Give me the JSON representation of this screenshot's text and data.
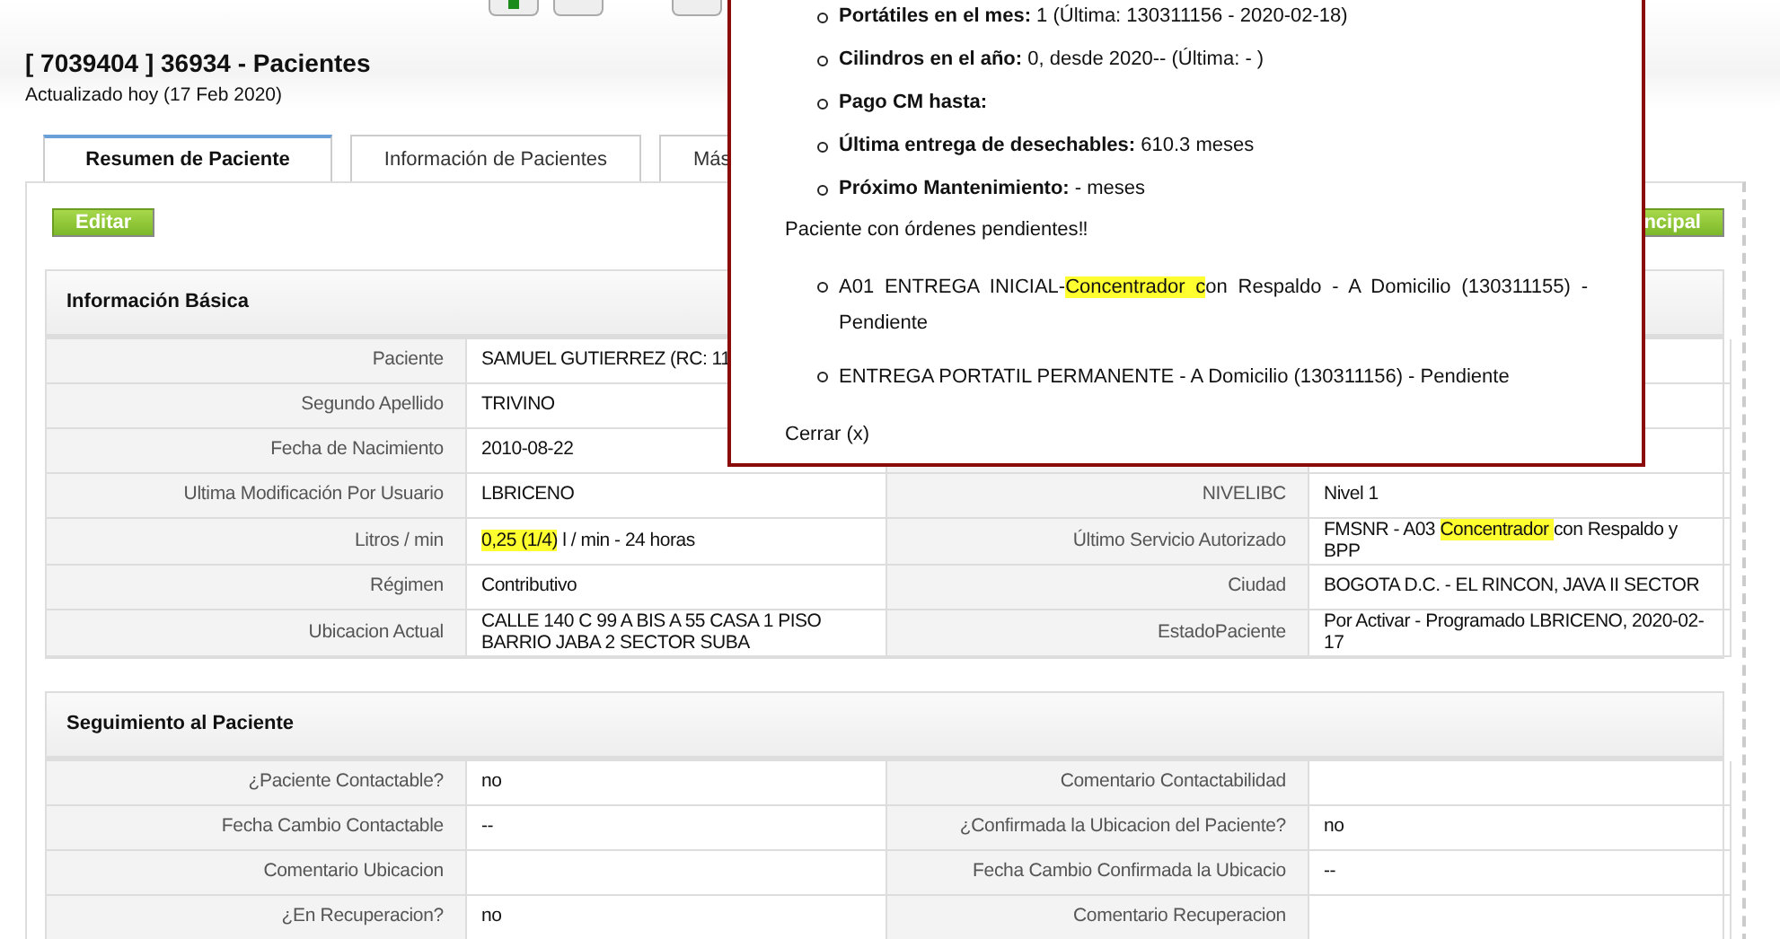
{
  "header": {
    "title": "[ 7039404 ] 36934 - Pacientes",
    "subtitle": "Actualizado hoy (17 Feb 2020)"
  },
  "tabs": [
    {
      "label": "Resumen de Paciente",
      "selected": true
    },
    {
      "label": "Información de Pacientes",
      "selected": false
    },
    {
      "label": "Más",
      "selected": false
    }
  ],
  "actions": {
    "edit": "Editar",
    "right_button": "ncipal"
  },
  "basic_info": {
    "title": "Información Básica",
    "rows": [
      {
        "left": {
          "label": "Paciente",
          "value": [
            {
              "text": "SAMUEL GUTIERREZ (RC: 11",
              "highlighted": false
            }
          ]
        }
      },
      {
        "left": {
          "label": "Segundo Apellido",
          "value": [
            {
              "text": "TRIVINO",
              "highlighted": false
            }
          ]
        }
      },
      {
        "left": {
          "label": "Fecha de Nacimiento",
          "value": [
            {
              "text": "2010-08-22",
              "highlighted": false
            }
          ]
        }
      },
      {
        "left": {
          "label": "Ultima Modificación Por Usuario",
          "value": [
            {
              "text": "LBRICENO",
              "highlighted": false
            }
          ]
        },
        "right": {
          "label": "NIVELIBC",
          "value": [
            {
              "text": "Nivel 1",
              "highlighted": false
            }
          ]
        }
      },
      {
        "left": {
          "label": "Litros / min",
          "value": [
            {
              "text": "0,25 (1/4)",
              "highlighted": true
            },
            {
              "text": " l / min - 24 horas",
              "highlighted": false
            }
          ]
        },
        "right": {
          "label": "Último Servicio Autorizado",
          "value": [
            {
              "text": "FMSNR - A03 ",
              "highlighted": false
            },
            {
              "text": "Concentrador ",
              "highlighted": true
            },
            {
              "text": "con Respaldo y BPP",
              "highlighted": false
            }
          ]
        }
      },
      {
        "left": {
          "label": "Régimen",
          "value": [
            {
              "text": "Contributivo",
              "highlighted": false
            }
          ]
        },
        "right": {
          "label": "Ciudad",
          "value": [
            {
              "text": "BOGOTA D.C. - EL RINCON, JAVA II SECTOR",
              "highlighted": false
            }
          ]
        }
      },
      {
        "left": {
          "label": "Ubicacion Actual",
          "value": [
            {
              "text": "CALLE 140 C 99 A BIS A 55 CASA 1 PISO BARRIO JABA 2 SECTOR SUBA",
              "highlighted": false
            }
          ]
        },
        "right": {
          "label": "EstadoPaciente",
          "value": [
            {
              "text": "Por Activar - Programado LBRICENO, 2020-02-17",
              "highlighted": false
            }
          ]
        }
      }
    ]
  },
  "follow_up": {
    "title": "Seguimiento al Paciente",
    "rows": [
      {
        "left": {
          "label": "¿Paciente Contactable?",
          "value": [
            {
              "text": "no",
              "highlighted": false
            }
          ]
        },
        "right": {
          "label": "Comentario Contactabilidad"
        }
      },
      {
        "left": {
          "label": "Fecha Cambio Contactable",
          "value": [
            {
              "text": "--",
              "highlighted": false
            }
          ]
        },
        "right": {
          "label": "¿Confirmada la Ubicacion del Paciente?",
          "value": [
            {
              "text": "no",
              "highlighted": false
            }
          ]
        }
      },
      {
        "left": {
          "label": "Comentario Ubicacion"
        },
        "right": {
          "label": "Fecha Cambio Confirmada la Ubicacio",
          "value": [
            {
              "text": "--",
              "highlighted": false
            }
          ]
        }
      },
      {
        "left": {
          "label": "¿En Recuperacion?",
          "value": [
            {
              "text": "no",
              "highlighted": false
            }
          ]
        },
        "right": {
          "label": "Comentario Recuperacion"
        }
      }
    ]
  },
  "popup": {
    "summary": [
      "**Portátiles en el mes:** 1 (Última: 130311156 - 2020-02-18)",
      "**Cilindros en el año:** 0, desde 2020-- (Última: - )",
      "**Pago CM hasta:**",
      "**Última entrega de desechables:** 610.3 meses",
      "**Próximo Mantenimiento:** - meses"
    ],
    "pending_title": "Paciente con órdenes pendientes‼",
    "pending_orders": [
      [
        {
          "text": "A01 ENTREGA INICIAL-",
          "highlighted": false
        },
        {
          "text": "Concentrador c",
          "highlighted": true
        },
        {
          "text": "on Respaldo - A Domicilio (130311155) - Pendiente",
          "highlighted": false
        }
      ],
      [
        {
          "text": "ENTREGA PORTATIL PERMANENTE - A Domicilio (130311156) - Pendiente",
          "highlighted": false
        }
      ]
    ],
    "close": "Cerrar (x)"
  }
}
